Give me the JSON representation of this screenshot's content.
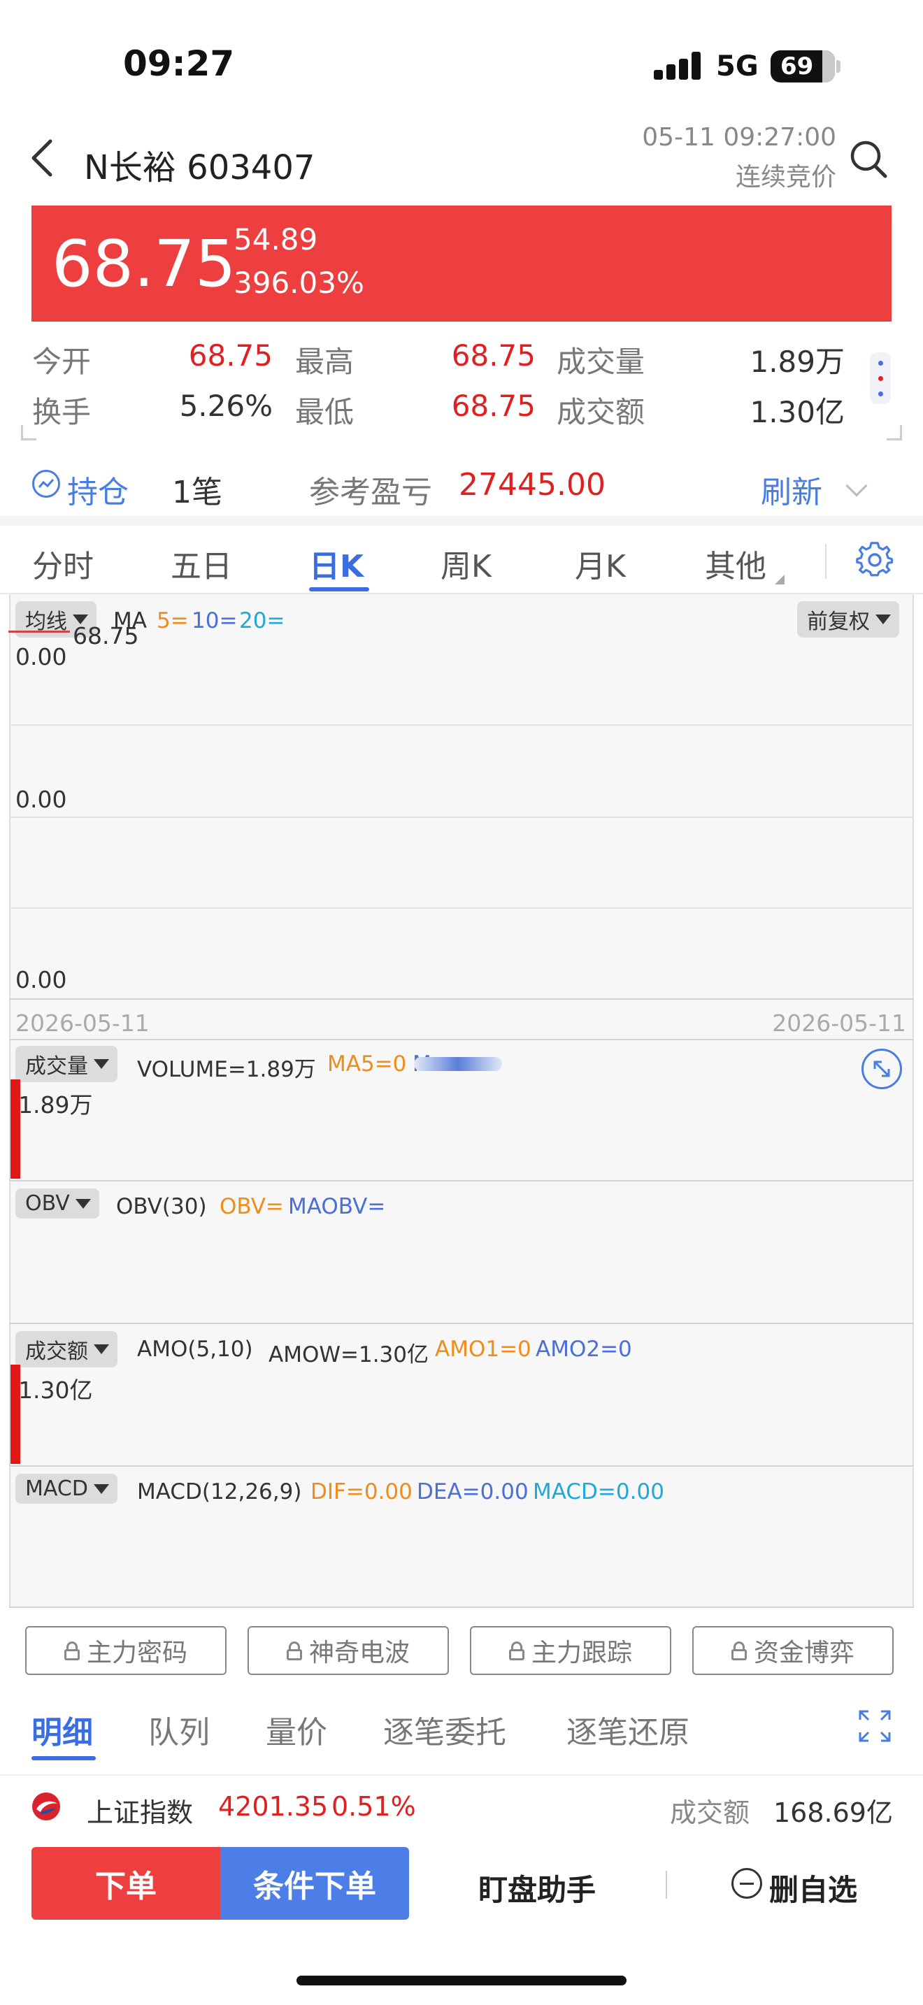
{
  "status_bar": {
    "time": "09:27",
    "network": "5G",
    "battery": "69"
  },
  "header": {
    "stock_name": "N长裕 603407",
    "datetime": "05-11 09:27:00",
    "phase": "连续竞价"
  },
  "banner": {
    "price": "68.75",
    "change": "54.89",
    "change_pct": "396.03%"
  },
  "quote": {
    "open_label": "今开",
    "open": "68.75",
    "high_label": "最高",
    "high": "68.75",
    "volume_label": "成交量",
    "volume": "1.89万",
    "turnover_label": "换手",
    "turnover": "5.26%",
    "low_label": "最低",
    "low": "68.75",
    "amount_label": "成交额",
    "amount": "1.30亿"
  },
  "position": {
    "label": "持仓",
    "count": "1笔",
    "pnl_label": "参考盈亏",
    "pnl": "27445.00",
    "refresh": "刷新"
  },
  "period_tabs": [
    {
      "label": "分时"
    },
    {
      "label": "五日"
    },
    {
      "label": "日K"
    },
    {
      "label": "周K"
    },
    {
      "label": "月K"
    },
    {
      "label": "其他"
    }
  ],
  "chart": {
    "ma_selector": "均线",
    "ma_label": "MA",
    "ma5": "5=",
    "ma10": "10=",
    "ma20": "20=",
    "adjust": "前复权",
    "last_price": "68.75",
    "y_top": "0.00",
    "y_mid": "0.00",
    "y_bottom": "0.00",
    "date_left": "2026-05-11",
    "date_right": "2026-05-11",
    "volume_panel": {
      "selector": "成交量",
      "text": "VOLUME=1.89万",
      "ma5": "MA5=0",
      "ma10_cut": "M",
      "value": "1.89万"
    },
    "obv_panel": {
      "selector": "OBV",
      "text": "OBV(30)",
      "obv": "OBV=",
      "maobv": "MAOBV="
    },
    "amo_panel": {
      "selector": "成交额",
      "text": "AMO(5,10)",
      "amow": "AMOW=1.30亿",
      "amo1": "AMO1=0",
      "amo2": "AMO2=0",
      "value": "1.30亿"
    },
    "macd_panel": {
      "selector": "MACD",
      "text": "MACD(12,26,9)",
      "dif": "DIF=0.00",
      "dea": "DEA=0.00",
      "macd": "MACD=0.00"
    }
  },
  "locked_features": [
    {
      "label": "主力密码"
    },
    {
      "label": "神奇电波"
    },
    {
      "label": "主力跟踪"
    },
    {
      "label": "资金博弈"
    }
  ],
  "detail_tabs": [
    {
      "label": "明细"
    },
    {
      "label": "队列"
    },
    {
      "label": "量价"
    },
    {
      "label": "逐笔委托"
    },
    {
      "label": "逐笔还原"
    }
  ],
  "index_bar": {
    "name": "上证指数",
    "value": "4201.35",
    "change_pct": "0.51%",
    "amount_label": "成交额",
    "amount": "168.69亿"
  },
  "actions": {
    "order": "下单",
    "conditional_order": "条件下单",
    "assistant": "盯盘助手",
    "remove_watchlist": "删自选"
  },
  "colors": {
    "up_red": "#ee3f40",
    "accent_blue": "#3a6ee0",
    "ma5_orange": "#f08c1a",
    "ma10_blue": "#4a6fd8",
    "ma20_cyan": "#1fa8d8"
  }
}
